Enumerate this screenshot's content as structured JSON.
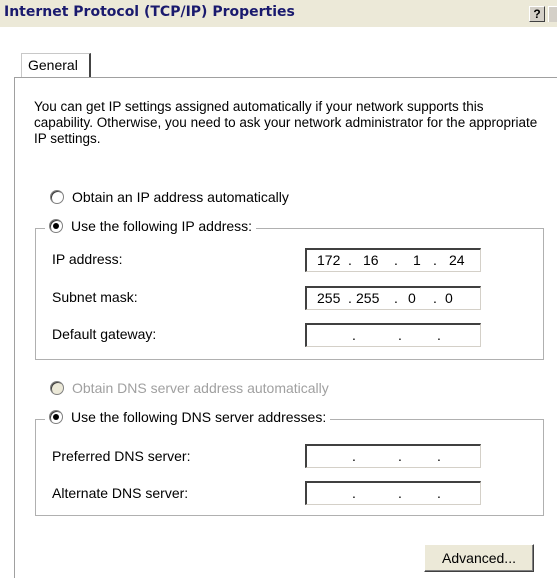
{
  "window": {
    "title": "Internet Protocol (TCP/IP) Properties",
    "help_label": "?"
  },
  "tabs": [
    {
      "label": "General"
    }
  ],
  "intro_text": "You can get IP settings assigned automatically if your network supports this capability. Otherwise, you need to ask your network administrator for the appropriate IP settings.",
  "ip": {
    "auto_label": "Obtain an IP address automatically",
    "manual_label": "Use the following IP address:",
    "selected": "manual",
    "fields": [
      {
        "label": "IP address:",
        "octets": [
          "172",
          "16",
          "1",
          "24"
        ]
      },
      {
        "label": "Subnet mask:",
        "octets": [
          "255",
          "255",
          "0",
          "0"
        ]
      },
      {
        "label": "Default gateway:",
        "octets": [
          "",
          "",
          "",
          ""
        ]
      }
    ]
  },
  "dns": {
    "auto_label": "Obtain DNS server address automatically",
    "auto_disabled": true,
    "manual_label": "Use the following DNS server addresses:",
    "selected": "manual",
    "fields": [
      {
        "label": "Preferred DNS server:",
        "octets": [
          "",
          "",
          "",
          ""
        ]
      },
      {
        "label": "Alternate DNS server:",
        "octets": [
          "",
          "",
          "",
          ""
        ]
      }
    ]
  },
  "buttons": {
    "advanced_label": "Advanced..."
  },
  "colors": {
    "titlebar": "#ece9d8",
    "title_text": "#1a1a6e",
    "disabled_text": "#a0a0a0"
  }
}
